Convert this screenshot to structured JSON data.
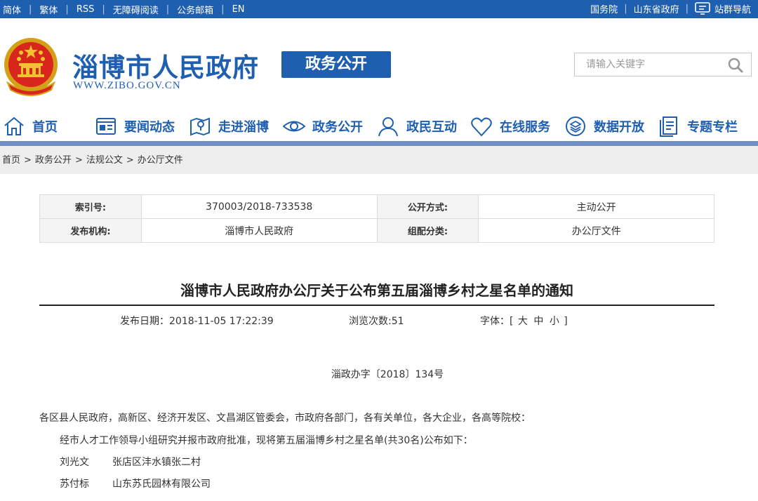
{
  "topbar": {
    "left_links": [
      "简体",
      "繁体",
      "RSS",
      "无障碍阅读",
      "公务邮箱",
      "EN"
    ],
    "right_links": [
      "国务院",
      "山东省政府"
    ],
    "nav_guide": "站群导航"
  },
  "header": {
    "site_name": "淄博市人民政府",
    "site_url": "WWW.ZIBO.GOV.CN",
    "section_badge": "政务公开",
    "search_placeholder": "请输入关键字"
  },
  "nav": {
    "items": [
      {
        "label": "首页",
        "icon": "home-icon"
      },
      {
        "label": "要闻动态",
        "icon": "news-icon"
      },
      {
        "label": "走进淄博",
        "icon": "map-icon"
      },
      {
        "label": "政务公开",
        "icon": "eye-icon"
      },
      {
        "label": "政民互动",
        "icon": "user-icon"
      },
      {
        "label": "在线服务",
        "icon": "heart-icon"
      },
      {
        "label": "数据开放",
        "icon": "layers-icon"
      },
      {
        "label": "专题专栏",
        "icon": "document-icon"
      }
    ],
    "accent_color": "#1f5fb0"
  },
  "breadcrumb": [
    "首页",
    "政务公开",
    "法规公文",
    "办公厅文件"
  ],
  "info": {
    "index_label": "索引号:",
    "index_value": "370003/2018-733538",
    "mode_label": "公开方式:",
    "mode_value": "主动公开",
    "org_label": "发布机构:",
    "org_value": "淄博市人民政府",
    "cat_label": "组配分类:",
    "cat_value": "办公厅文件"
  },
  "article": {
    "title": "淄博市人民政府办公厅关于公布第五届淄博乡村之星名单的通知",
    "publish_date": "发布日期：2018-11-05 17:22:39",
    "views": "浏览次数:51",
    "font_label": "字体：[",
    "font_large": "大",
    "font_medium": "中",
    "font_small": "小",
    "font_close": "]",
    "doc_number": "淄政办字〔2018〕134号",
    "recipients": "各区县人民政府，高新区、经济开发区、文昌湖区管委会，市政府各部门，各有关单位，各大企业，各高等院校：",
    "body": "经市人才工作领导小组研究并报市政府批准，现将第五届淄博乡村之星名单(共30名)公布如下：",
    "list": [
      {
        "name": "刘光文",
        "unit": "张店区沣水镇张二村"
      },
      {
        "name": "苏付标",
        "unit": "山东苏氏园林有限公司"
      }
    ]
  }
}
